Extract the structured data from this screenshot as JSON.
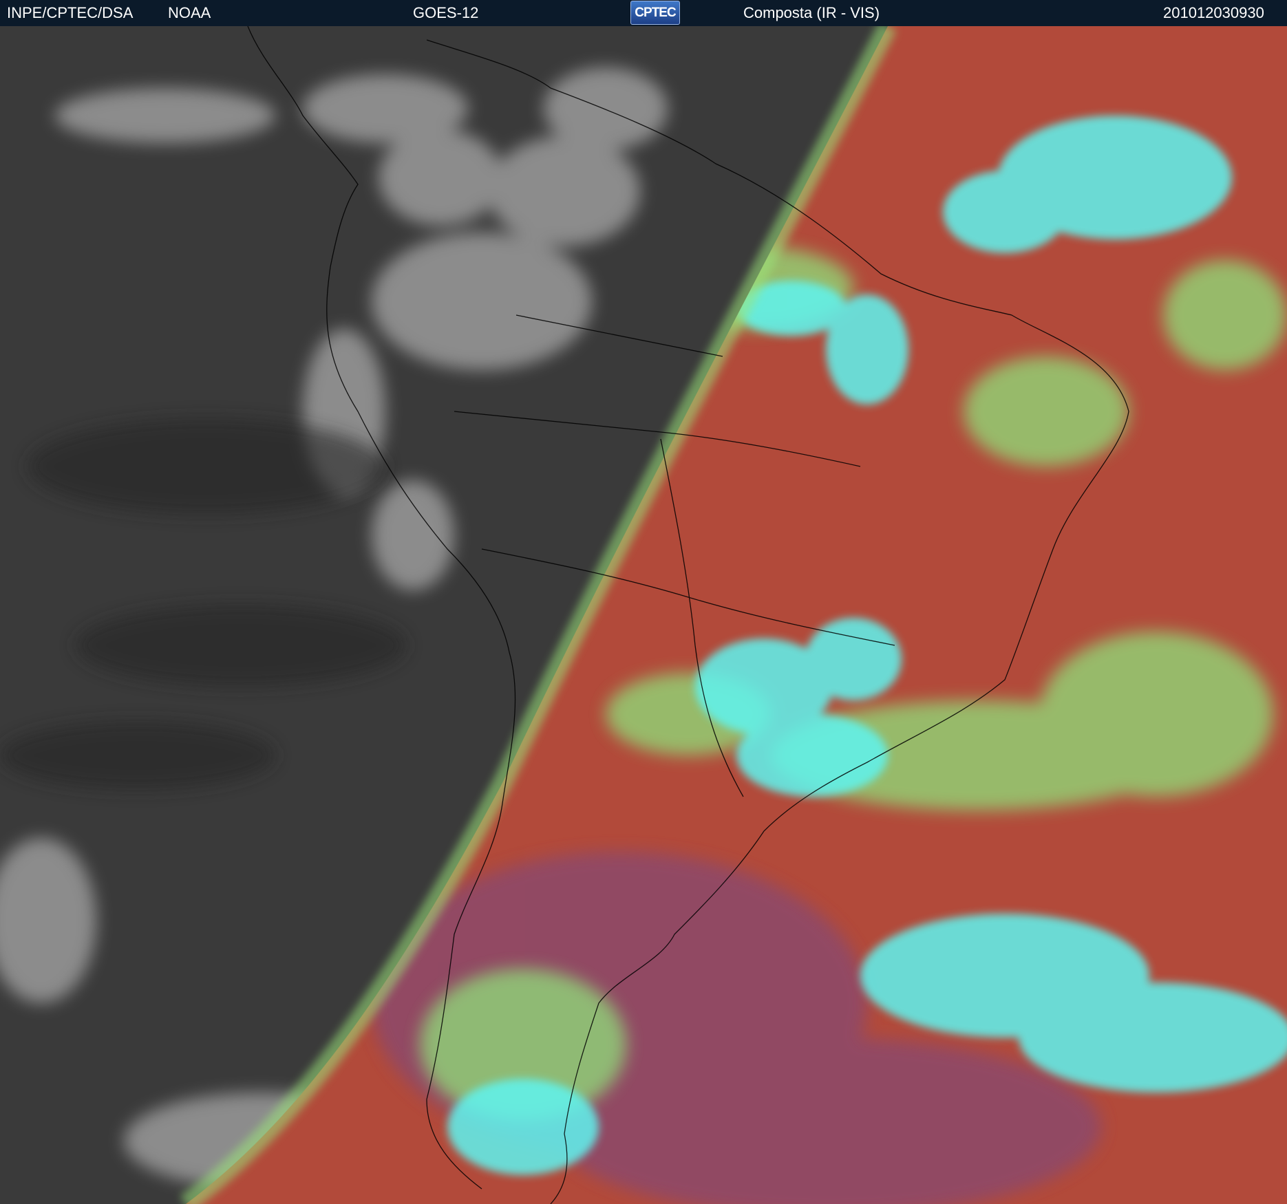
{
  "header": {
    "agency": "INPE/CPTEC/DSA",
    "partner": "NOAA",
    "satellite": "GOES-12",
    "logo_text": "CPTEC",
    "product": "Composta (IR - VIS)",
    "timestamp": "201012030930"
  },
  "colors": {
    "header_bg": "#0b1a2a",
    "ir_bg": "#3a3a3a",
    "vis_bg": "#b24a3a",
    "cloud_cyan": "#5ff4f0",
    "cloud_green": "#8fe07a",
    "coastline": "#000000"
  }
}
